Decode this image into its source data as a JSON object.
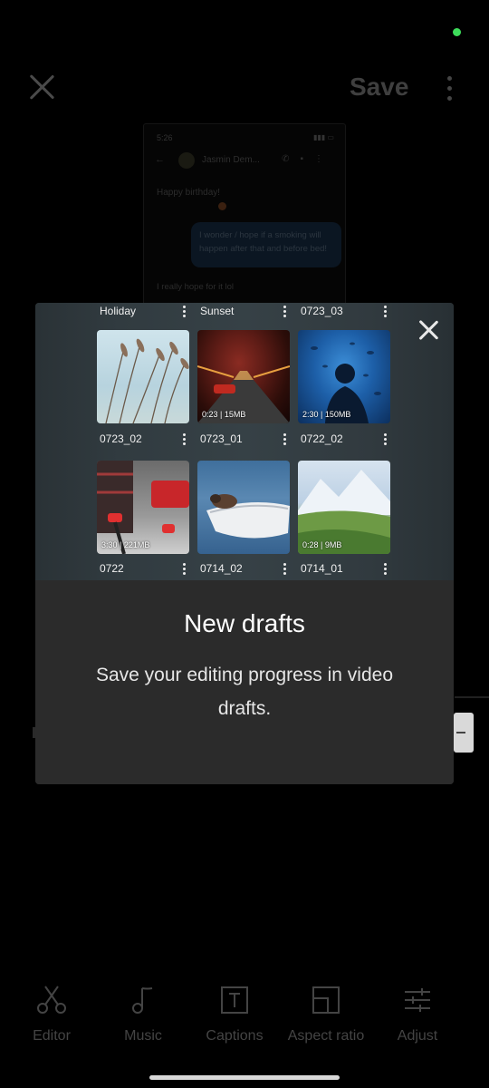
{
  "header": {
    "save_label": "Save"
  },
  "preview": {
    "time": "5:26",
    "contact_name": "Jasmin Dem...",
    "message_1": "Happy birthday!",
    "bubble_text": "I wonder / hope if a smoking will happen after that and before bed!",
    "message_2": "I really hope for it lol"
  },
  "modal": {
    "top_labels": [
      "Holiday",
      "Sunset",
      "0723_03"
    ],
    "tiles": [
      {
        "label": "0723_02",
        "meta": "",
        "style": "reeds"
      },
      {
        "label": "0723_01",
        "meta": "0:23 | 15MB",
        "style": "tunnel"
      },
      {
        "label": "0722_02",
        "meta": "2:30 | 150MB",
        "style": "aquarium"
      },
      {
        "label": "0722",
        "meta": "3:30 | 221MB",
        "style": "skate"
      },
      {
        "label": "0714_02",
        "meta": "",
        "style": "boat"
      },
      {
        "label": "0714_01",
        "meta": "0:28 | 9MB",
        "style": "mountain"
      }
    ],
    "title": "New drafts",
    "body": "Save your editing progress in video drafts."
  },
  "toolbar": {
    "items": [
      {
        "label": "Editor",
        "icon": "scissors-icon"
      },
      {
        "label": "Music",
        "icon": "music-note-icon"
      },
      {
        "label": "Captions",
        "icon": "text-box-icon"
      },
      {
        "label": "Aspect ratio",
        "icon": "aspect-ratio-icon"
      },
      {
        "label": "Adjust",
        "icon": "sliders-icon"
      }
    ]
  },
  "colors": {
    "status_dot": "#3ddc5a",
    "modal_bg": "#2b2b2b"
  }
}
